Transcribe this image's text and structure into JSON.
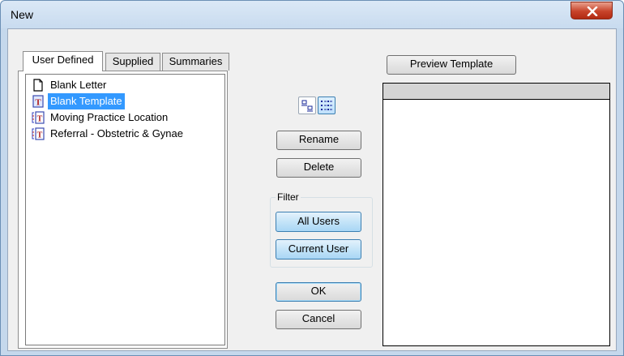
{
  "window": {
    "title": "New"
  },
  "tabs": [
    {
      "label": "User Defined",
      "active": true
    },
    {
      "label": "Supplied",
      "active": false
    },
    {
      "label": "Summaries",
      "active": false
    }
  ],
  "templates": [
    {
      "label": "Blank Letter",
      "icon": "blank-page-icon",
      "selected": false
    },
    {
      "label": "Blank Template",
      "icon": "template-t-icon",
      "selected": true
    },
    {
      "label": "Moving Practice Location",
      "icon": "linked-template-icon",
      "selected": false
    },
    {
      "label": "Referral - Obstetric & Gynae",
      "icon": "linked-template-icon",
      "selected": false
    }
  ],
  "view_toggle": {
    "small_icons": "small-icons-view-icon",
    "list": "list-view-icon"
  },
  "actions": {
    "rename": "Rename",
    "delete": "Delete"
  },
  "filter": {
    "label": "Filter",
    "all_users": "All Users",
    "current_user": "Current User",
    "selected": "all_users"
  },
  "dialog": {
    "ok": "OK",
    "cancel": "Cancel"
  },
  "preview": {
    "button": "Preview Template"
  },
  "colors": {
    "selection": "#3399ff",
    "title_bar": "#c5d8ec",
    "close": "#c7432a"
  }
}
